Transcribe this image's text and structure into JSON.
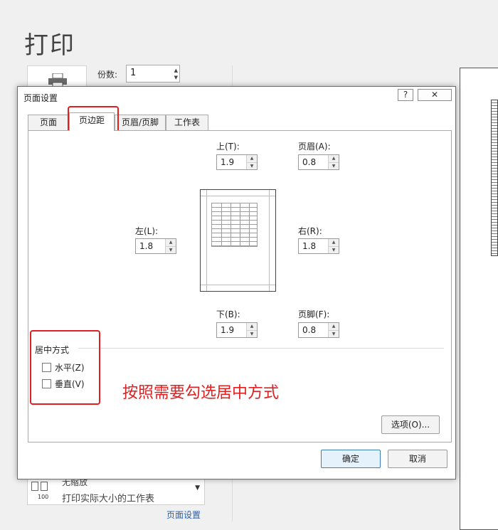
{
  "background": {
    "title": "打印",
    "copies_label": "份数:",
    "copies_value": "1",
    "scaling_title": "无缩放",
    "scaling_desc": "打印实际大小的工作表",
    "scaling_number": "100",
    "page_setup_link": "页面设置"
  },
  "dialog": {
    "title": "页面设置",
    "help_label": "?",
    "close_label": "✕",
    "tabs": [
      {
        "label": "页面",
        "active": false
      },
      {
        "label": "页边距",
        "active": true
      },
      {
        "label": "页眉/页脚",
        "active": false
      },
      {
        "label": "工作表",
        "active": false
      }
    ],
    "margins": {
      "top_label": "上(T):",
      "top_value": "1.9",
      "header_label": "页眉(A):",
      "header_value": "0.8",
      "left_label": "左(L):",
      "left_value": "1.8",
      "right_label": "右(R):",
      "right_value": "1.8",
      "bottom_label": "下(B):",
      "bottom_value": "1.9",
      "footer_label": "页脚(F):",
      "footer_value": "0.8"
    },
    "centering": {
      "section_label": "居中方式",
      "horizontal_label": "水平(Z)",
      "horizontal_checked": false,
      "vertical_label": "垂直(V)",
      "vertical_checked": false
    },
    "options_button": "选项(O)...",
    "ok_button": "确定",
    "cancel_button": "取消"
  },
  "annotation_text": "按照需要勾选居中方式",
  "colors": {
    "annotation": "#e02020",
    "link": "#2a5fa8",
    "primary_button_border": "#3c7fb1"
  }
}
